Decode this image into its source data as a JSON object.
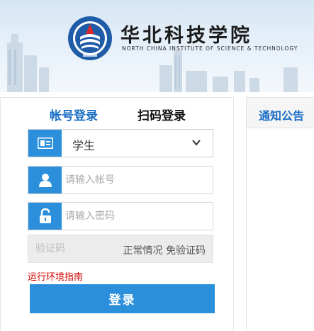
{
  "header": {
    "school_name_cn": "华北科技学院",
    "school_name_en": "NORTH CHINA INSTITUTE OF SCIENCE & TECHNOLOGY",
    "emblem_text": "华北科技学院",
    "emblem_icon": "school-emblem-icon"
  },
  "login": {
    "tabs": {
      "account": "帐号登录",
      "qrcode": "扫码登录"
    },
    "role": {
      "icon": "id-card-icon",
      "value": "学生",
      "chevron_icon": "chevron-down-icon"
    },
    "username": {
      "icon": "user-icon",
      "placeholder": "请输入帐号",
      "value": ""
    },
    "password": {
      "icon": "lock-icon",
      "placeholder": "请输入密码",
      "value": ""
    },
    "captcha": {
      "placeholder": "验证码",
      "note": "正常情况 免验证码"
    },
    "env_guide": "运行环境指南",
    "submit": "登录"
  },
  "notice": {
    "title": "通知公告"
  },
  "colors": {
    "accent_blue": "#2b8fdc",
    "tab_active": "#1c6fc4",
    "warning_red": "#d40000"
  }
}
